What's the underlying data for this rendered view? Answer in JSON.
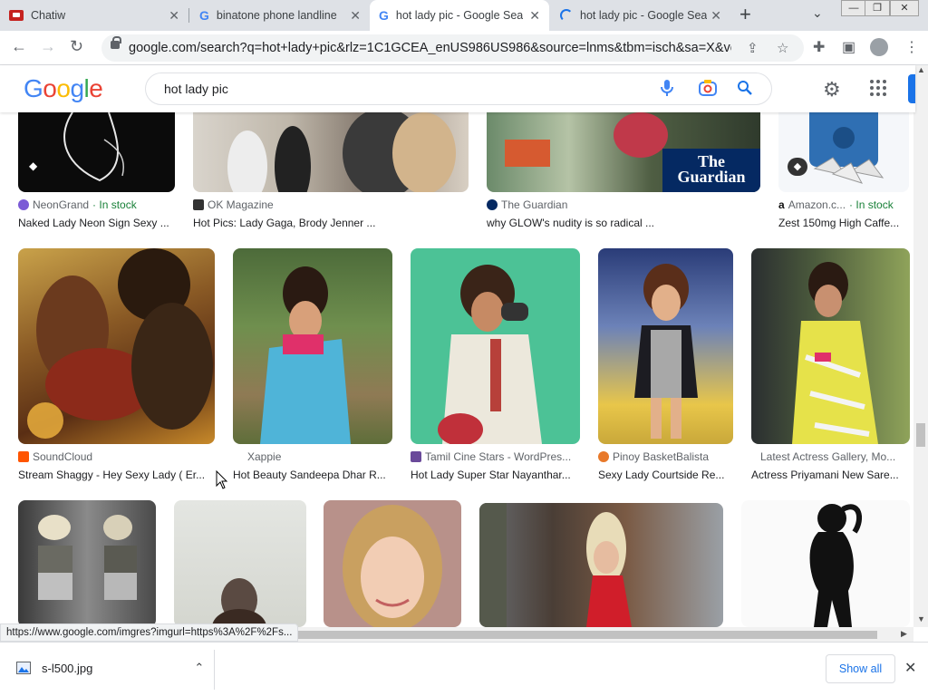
{
  "browser": {
    "tabs": [
      {
        "title": "Chatiw",
        "favicon": "chatiw-icon"
      },
      {
        "title": "binatone phone landline",
        "favicon": "google-g-icon"
      },
      {
        "title": "hot lady pic - Google Sea",
        "favicon": "google-g-icon",
        "active": true
      },
      {
        "title": "hot lady pic - Google Sea",
        "favicon": "loading-spinner-icon"
      }
    ],
    "url": "google.com/search?q=hot+lady+pic&rlz=1C1GCEA_enUS986US986&source=lnms&tbm=isch&sa=X&ved...",
    "status_url": "https://www.google.com/imgres?imgurl=https%3A%2F%2Fs..."
  },
  "google": {
    "logo": [
      "G",
      "o",
      "o",
      "g",
      "l",
      "e"
    ],
    "query": "hot lady pic"
  },
  "row1": [
    {
      "source": "NeonGrand",
      "stock": "· In stock",
      "caption": "Naked Lady Neon Sign Sexy ..."
    },
    {
      "source": "OK Magazine",
      "stock": "",
      "caption": "Hot Pics: Lady Gaga, Brody Jenner ..."
    },
    {
      "source": "The Guardian",
      "stock": "",
      "caption": "why GLOW's nudity is so radical ..."
    },
    {
      "source": "Amazon.c...",
      "stock": "· In stock",
      "caption": "Zest 150mg High Caffe..."
    }
  ],
  "guardian_logo": "The Guardian",
  "row2": [
    {
      "source": "SoundCloud",
      "caption": "Stream Shaggy - Hey Sexy Lady ( Er..."
    },
    {
      "source": "Xappie",
      "caption": "Hot Beauty Sandeepa Dhar R..."
    },
    {
      "source": "Tamil Cine Stars - WordPres...",
      "caption": "Hot Lady Super Star Nayanthar..."
    },
    {
      "source": "Pinoy BasketBalista",
      "caption": "Sexy Lady Courtside Re..."
    },
    {
      "source": "Latest Actress Gallery, Mo...",
      "caption": "Actress Priyamani New Sare..."
    }
  ],
  "download": {
    "filename": "s-l500.jpg",
    "show_all": "Show all"
  },
  "colors": {
    "google_blue": "#4285f4",
    "google_red": "#ea4335",
    "google_yellow": "#fbbc05",
    "google_green": "#34a853",
    "link_blue": "#1a73e8",
    "stock_green": "#188038"
  }
}
